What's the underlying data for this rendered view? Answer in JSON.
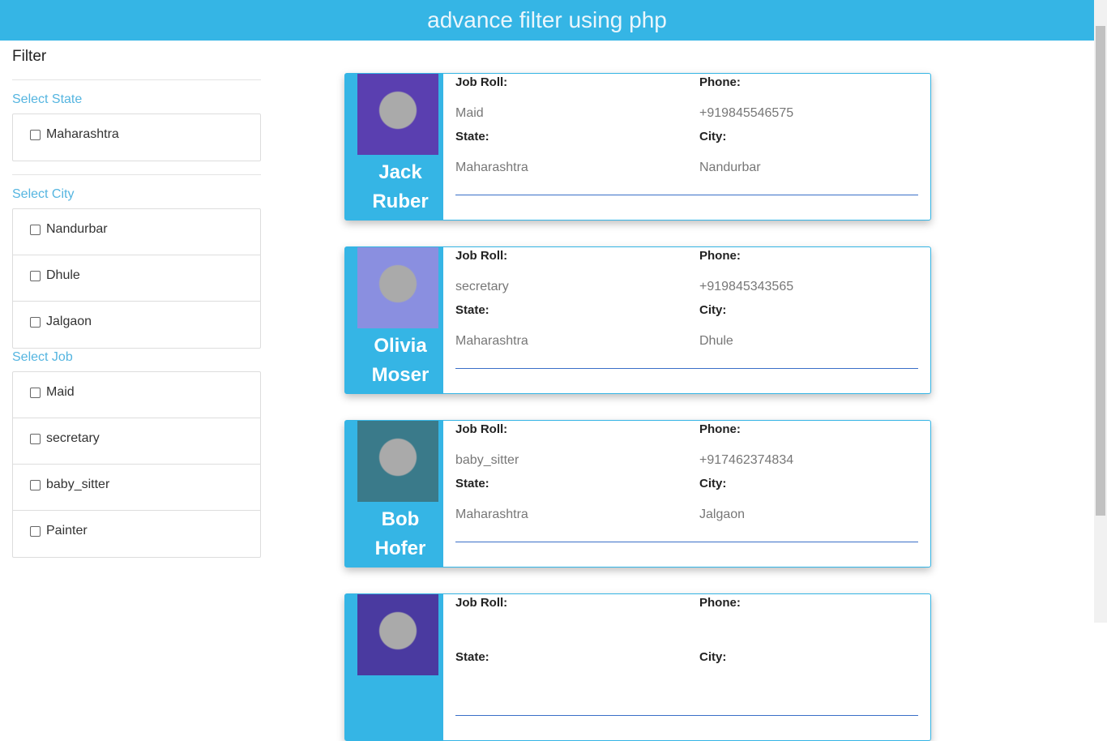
{
  "header": {
    "title": "advance filter using php"
  },
  "sidebar": {
    "title": "Filter",
    "state": {
      "label": "Select State",
      "options": [
        "Maharashtra"
      ]
    },
    "city": {
      "label": "Select City",
      "options": [
        "Nandurbar",
        "Dhule",
        "Jalgaon"
      ]
    },
    "job": {
      "label": "Select Job",
      "options": [
        "Maid",
        "secretary",
        "baby_sitter",
        "Painter"
      ]
    }
  },
  "labels": {
    "job": "Job Roll:",
    "phone": "Phone:",
    "state": "State:",
    "city": "City:"
  },
  "cards": [
    {
      "first": "Jack",
      "last": "Ruber",
      "job": "Maid",
      "phone": "+919845546575",
      "state": "Maharashtra",
      "city": "Nandurbar",
      "avatar_color": "#5a3fb0"
    },
    {
      "first": "Olivia",
      "last": "Moser",
      "job": "secretary",
      "phone": "+919845343565",
      "state": "Maharashtra",
      "city": "Dhule",
      "avatar_color": "#8a8fe0"
    },
    {
      "first": "Bob",
      "last": "Hofer",
      "job": "baby_sitter",
      "phone": "+917462374834",
      "state": "Maharashtra",
      "city": "Jalgaon",
      "avatar_color": "#3a7a8a"
    },
    {
      "avatar_color": "#4a3aa0"
    }
  ],
  "colors": {
    "accent": "#35b5e5"
  }
}
